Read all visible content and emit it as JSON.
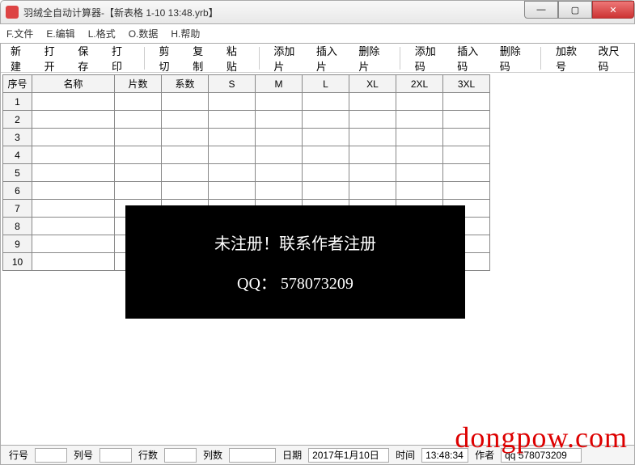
{
  "window": {
    "title": "羽绒全自动计算器-【新表格 1-10 13:48.yrb】",
    "controls": {
      "min": "—",
      "max": "▢",
      "close": "✕"
    }
  },
  "menu": {
    "file": "F.文件",
    "edit": "E.编辑",
    "format": "L.格式",
    "data": "O.数据",
    "help": "H.帮助"
  },
  "toolbar": {
    "new": "新建",
    "open": "打开",
    "save": "保存",
    "print": "打印",
    "cut": "剪切",
    "copy": "复制",
    "paste": "粘贴",
    "add_piece": "添加片",
    "insert_piece": "插入片",
    "delete_piece": "删除片",
    "add_size": "添加码",
    "insert_size": "插入码",
    "delete_size": "删除码",
    "add_style": "加款号",
    "change_size": "改尺码"
  },
  "grid": {
    "headers": {
      "rownum": "序号",
      "name": "名称",
      "pieces": "片数",
      "coef": "系数",
      "s": "S",
      "m": "M",
      "l": "L",
      "xl": "XL",
      "xxl": "2XL",
      "xxxl": "3XL"
    },
    "rows": [
      "1",
      "2",
      "3",
      "4",
      "5",
      "6",
      "7",
      "8",
      "9",
      "10"
    ]
  },
  "overlay": {
    "line1": "未注册！联系作者注册",
    "line2": "QQ： 578073209"
  },
  "status": {
    "row_lbl": "行号",
    "col_lbl": "列号",
    "rows_lbl": "行数",
    "cols_lbl": "列数",
    "date_lbl": "日期",
    "date_val": "2017年1月10日",
    "time_lbl": "时间",
    "time_val": "13:48:34",
    "author_lbl": "作者",
    "author_val": "qq 578073209"
  },
  "watermark": "dongpow.com"
}
